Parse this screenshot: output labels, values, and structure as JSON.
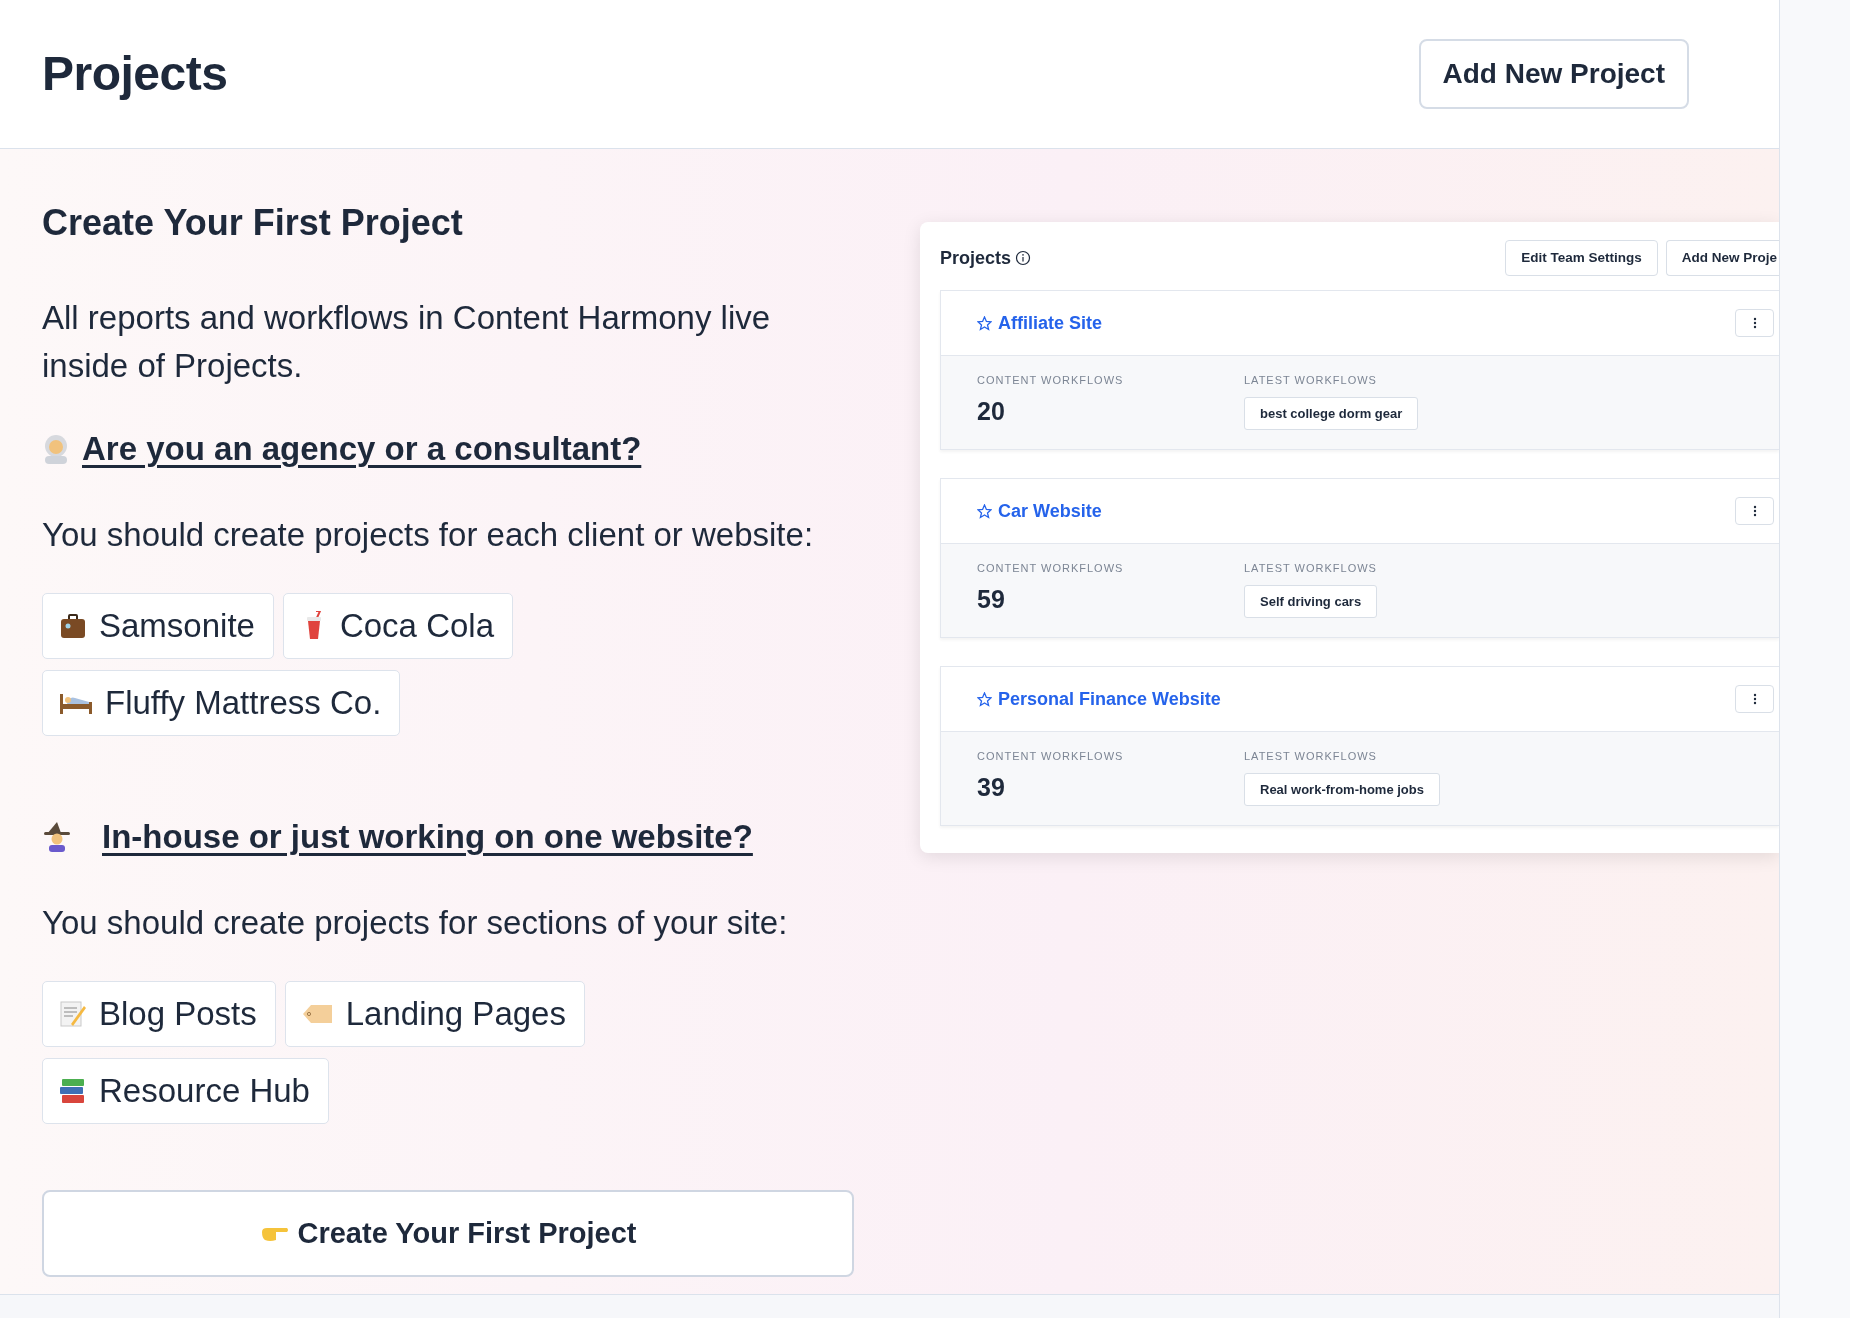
{
  "header": {
    "title": "Projects",
    "add_button": "Add New Project"
  },
  "intro": {
    "heading": "Create Your First Project",
    "paragraph": "All reports and workflows in Content Harmony live inside of Projects.",
    "sections": [
      {
        "question": "Are you an agency or a consultant?",
        "description": "You should create projects for each client or website:",
        "examples": [
          "Samsonite",
          "Coca Cola",
          "Fluffy Mattress Co."
        ]
      },
      {
        "question": "In-house or just working on one website?",
        "description": "You should create projects for sections of your site:",
        "examples": [
          "Blog Posts",
          "Landing Pages",
          "Resource Hub"
        ]
      }
    ],
    "create_button": "Create Your First Project"
  },
  "preview": {
    "title": "Projects",
    "buttons": [
      "Edit Team Settings",
      "Add New Proje"
    ],
    "projects": [
      {
        "name": "Affiliate Site",
        "starred": false,
        "count_label": "CONTENT WORKFLOWS",
        "count": "20",
        "latest_label": "LATEST WORKFLOWS",
        "latest": [
          "best college dorm gear"
        ]
      },
      {
        "name": "Car Website",
        "starred": false,
        "count_label": "CONTENT WORKFLOWS",
        "count": "59",
        "latest_label": "LATEST WORKFLOWS",
        "latest": [
          "Self driving cars"
        ]
      },
      {
        "name": "Personal Finance Website",
        "starred": false,
        "count_label": "CONTENT WORKFLOWS",
        "count": "39",
        "latest_label": "LATEST WORKFLOWS",
        "latest": [
          "Real work-from-home jobs"
        ]
      }
    ]
  }
}
